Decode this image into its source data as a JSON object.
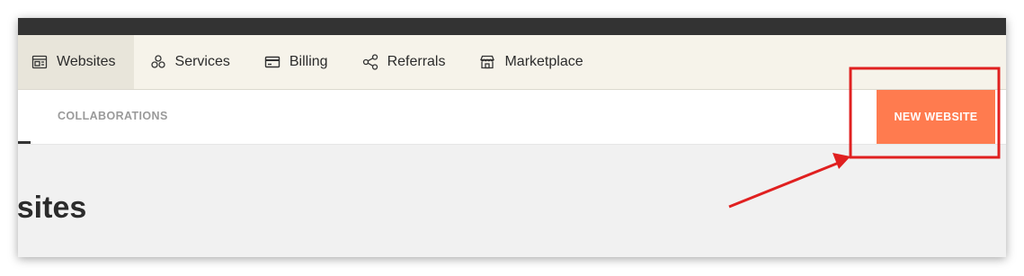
{
  "nav": {
    "items": [
      {
        "label": "Websites",
        "icon": "website-icon",
        "active": true
      },
      {
        "label": "Services",
        "icon": "services-icon",
        "active": false
      },
      {
        "label": "Billing",
        "icon": "credit-card-icon",
        "active": false
      },
      {
        "label": "Referrals",
        "icon": "share-icon",
        "active": false
      },
      {
        "label": "Marketplace",
        "icon": "store-icon",
        "active": false
      }
    ]
  },
  "subnav": {
    "tab_label": "COLLABORATIONS",
    "new_button_label": "NEW WEBSITE"
  },
  "page": {
    "title": "bsites"
  },
  "colors": {
    "accent": "#ff7b4f",
    "annotation": "#e02020",
    "topbar": "#333333",
    "nav_bg": "#f6f3ea"
  }
}
